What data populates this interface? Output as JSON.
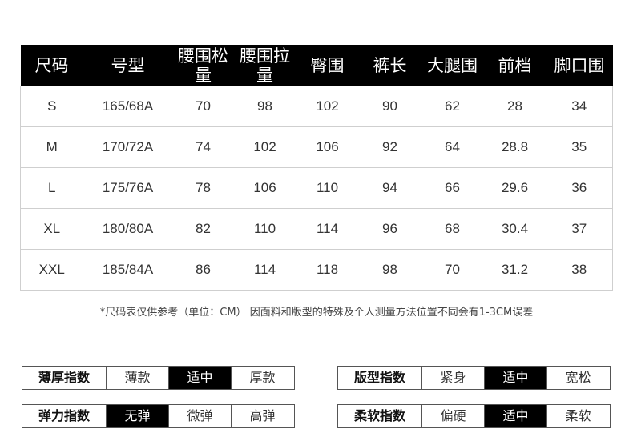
{
  "size_table": {
    "headers": [
      "尺码",
      "号型",
      "腰围松量",
      "腰围拉量",
      "臀围",
      "裤长",
      "大腿围",
      "前档",
      "脚口围"
    ],
    "rows": [
      [
        "S",
        "165/68A",
        "70",
        "98",
        "102",
        "90",
        "62",
        "28",
        "34"
      ],
      [
        "M",
        "170/72A",
        "74",
        "102",
        "106",
        "92",
        "64",
        "28.8",
        "35"
      ],
      [
        "L",
        "175/76A",
        "78",
        "106",
        "110",
        "94",
        "66",
        "29.6",
        "36"
      ],
      [
        "XL",
        "180/80A",
        "82",
        "110",
        "114",
        "96",
        "68",
        "30.4",
        "37"
      ],
      [
        "XXL",
        "185/84A",
        "86",
        "114",
        "118",
        "98",
        "70",
        "31.2",
        "38"
      ]
    ]
  },
  "note": "*尺码表仅供参考（单位：CM） 因面料和版型的特殊及个人测量方法位置不同会有1-3CM误差",
  "indices": {
    "thickness": {
      "label": "薄厚指数",
      "options": [
        "薄款",
        "适中",
        "厚款"
      ],
      "selected": 1
    },
    "elasticity": {
      "label": "弹力指数",
      "options": [
        "无弹",
        "微弹",
        "高弹"
      ],
      "selected": 0
    },
    "fit": {
      "label": "版型指数",
      "options": [
        "紧身",
        "适中",
        "宽松"
      ],
      "selected": 1
    },
    "softness": {
      "label": "柔软指数",
      "options": [
        "偏硬",
        "适中",
        "柔软"
      ],
      "selected": 1
    }
  },
  "colors": {
    "header_bg": "#000000",
    "header_text": "#ffffff",
    "selected_bg": "#000000",
    "border": "#cfcfcf"
  }
}
